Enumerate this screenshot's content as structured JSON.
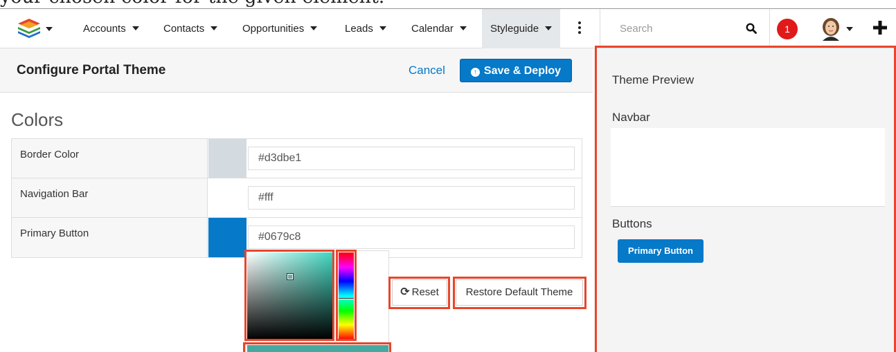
{
  "caption": "your chosen color for the given element.",
  "nav": {
    "items": [
      {
        "label": "Accounts"
      },
      {
        "label": "Contacts"
      },
      {
        "label": "Opportunities"
      },
      {
        "label": "Leads"
      },
      {
        "label": "Calendar"
      },
      {
        "label": "Styleguide"
      }
    ],
    "search_placeholder": "Search",
    "notification_count": "1"
  },
  "header": {
    "title": "Configure Portal Theme",
    "cancel_label": "Cancel",
    "save_label": "Save & Deploy"
  },
  "colors": {
    "section_title": "Colors",
    "rows": [
      {
        "label": "Border Color",
        "value": "#d3dbe1",
        "swatch": "#d3dbe1"
      },
      {
        "label": "Navigation Bar",
        "value": "#fff",
        "swatch": "#ffffff"
      },
      {
        "label": "Primary Button",
        "value": "#0679c8",
        "swatch": "#0679c8"
      }
    ]
  },
  "actions": {
    "reset_label": "Reset",
    "restore_label": "Restore Default Theme"
  },
  "preview": {
    "title": "Theme Preview",
    "navbar_label": "Navbar",
    "buttons_label": "Buttons",
    "primary_button_label": "Primary Button"
  },
  "theme": {
    "accent": "#0679c8",
    "highlight": "#e8452b",
    "badge": "#e0191a"
  }
}
